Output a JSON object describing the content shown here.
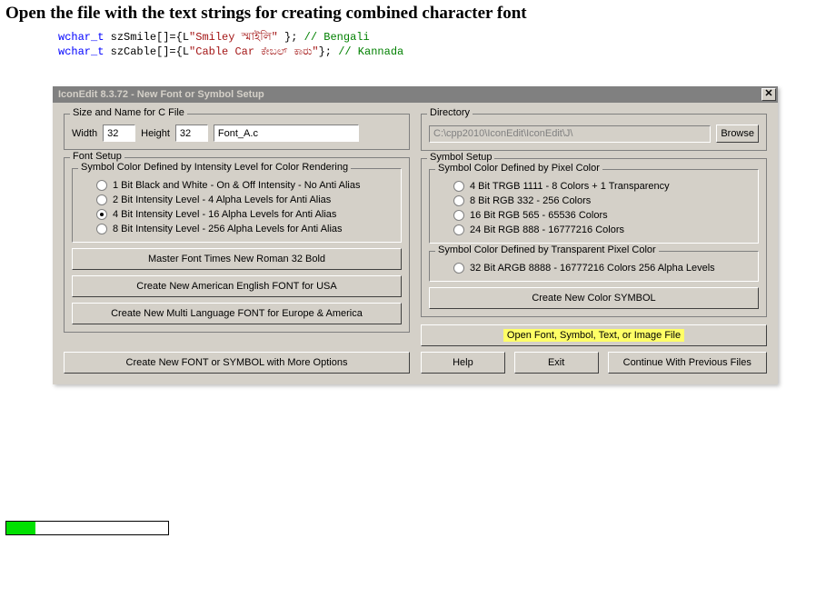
{
  "heading": "Open the file with the text strings for creating combined character font",
  "code": {
    "l1_type": "wchar_t",
    "l1_var": " szSmile[]={L",
    "l1_str": "\"Smiley স্মাইলি\"",
    "l1_tail": " }; ",
    "l1_cmt": "// Bengali",
    "l2_type": "wchar_t",
    "l2_var": " szCable[]={L",
    "l2_str": "\"Cable Car ಕೇಬಲ್ ಕಾರು\"",
    "l2_tail": "}; ",
    "l2_cmt": "// Kannada"
  },
  "titlebar": "IconEdit 8.3.72 - New Font or Symbol Setup",
  "size_group": "Size and Name for C File",
  "width_lbl": "Width",
  "width_val": "32",
  "height_lbl": "Height",
  "height_val": "32",
  "filename": "Font_A.c",
  "dir_group": "Directory",
  "dir_path": "C:\\cpp2010\\IconEdit\\IconEdit\\J\\",
  "browse": "Browse",
  "font_setup": "Font Setup",
  "font_intensity_group": "Symbol Color Defined by Intensity Level for Color Rendering",
  "font_r0": "1 Bit Black and White - On & Off Intensity - No Anti Alias",
  "font_r1": "2 Bit Intensity Level - 4 Alpha Levels for Anti Alias",
  "font_r2": "4 Bit Intensity Level - 16 Alpha Levels for Anti Alias",
  "font_r3": "8 Bit Intensity Level - 256 Alpha Levels for Anti Alias",
  "btn_master": "Master Font  Times New Roman 32 Bold",
  "btn_usa": "Create New American English FONT for USA",
  "btn_multi": "Create New Multi Language FONT for Europe & America",
  "symbol_setup": "Symbol Setup",
  "sym_pixel_group": "Symbol Color Defined by Pixel Color",
  "sym_r0": "4 Bit TRGB 1111 - 8 Colors + 1 Transparency",
  "sym_r1": "8 Bit RGB 332 - 256 Colors",
  "sym_r2": "16 Bit RGB 565 - 65536 Colors",
  "sym_r3": "24 Bit RGB 888 - 16777216 Colors",
  "sym_trans_group": "Symbol Color Defined by Transparent Pixel Color",
  "sym_r4": "32 Bit ARGB 8888 - 16777216 Colors 256 Alpha Levels",
  "btn_newsymbol": "Create New Color SYMBOL",
  "btn_open_highlight": "Open Font, Symbol, Text, or Image File",
  "btn_more": "Create New FONT or SYMBOL with More Options",
  "btn_help": "Help",
  "btn_exit": "Exit",
  "btn_continue": "Continue With Previous Files",
  "progress_percent": 18
}
